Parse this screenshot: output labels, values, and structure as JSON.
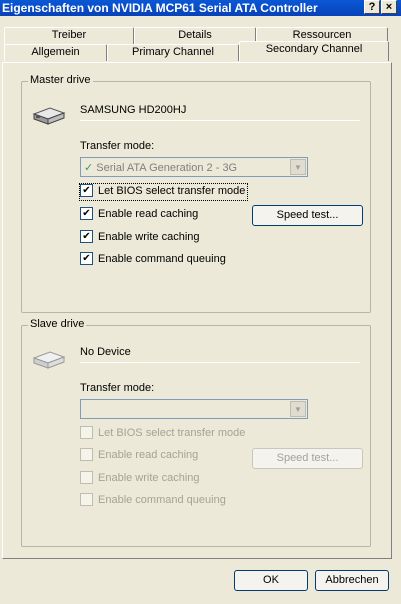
{
  "window": {
    "title": "Eigenschaften von NVIDIA MCP61 Serial ATA Controller",
    "help_label": "?",
    "close_label": "×"
  },
  "tabs_row1": [
    "Treiber",
    "Details",
    "Ressourcen"
  ],
  "tabs_row2": [
    "Allgemein",
    "Primary Channel",
    "Secondary Channel"
  ],
  "active_tab": "Secondary Channel",
  "master": {
    "group_label": "Master drive",
    "device_name": "SAMSUNG HD200HJ",
    "transfer_label": "Transfer mode:",
    "transfer_value": "Serial ATA Generation 2 - 3G",
    "checkboxes": [
      {
        "label": "Let BIOS select transfer mode",
        "checked": true
      },
      {
        "label": "Enable read caching",
        "checked": true
      },
      {
        "label": "Enable write caching",
        "checked": true
      },
      {
        "label": "Enable command queuing",
        "checked": true
      }
    ],
    "speed_test": "Speed test..."
  },
  "slave": {
    "group_label": "Slave drive",
    "device_name": "No Device",
    "transfer_label": "Transfer mode:",
    "transfer_value": "",
    "checkboxes": [
      {
        "label": "Let BIOS select transfer mode",
        "checked": false
      },
      {
        "label": "Enable read caching",
        "checked": false
      },
      {
        "label": "Enable write caching",
        "checked": false
      },
      {
        "label": "Enable command queuing",
        "checked": false
      }
    ],
    "speed_test": "Speed test..."
  },
  "footer": {
    "ok": "OK",
    "cancel": "Abbrechen"
  }
}
